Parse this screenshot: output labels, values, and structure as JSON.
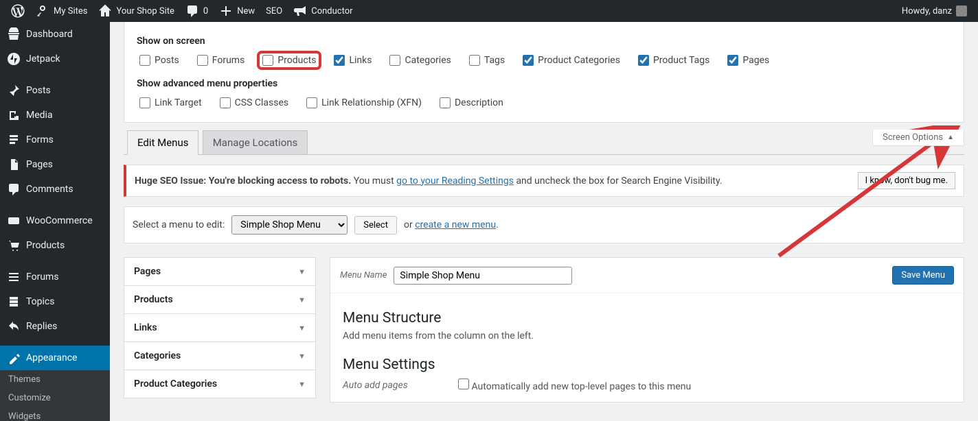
{
  "adminbar": {
    "my_sites": "My Sites",
    "site_name": "Your Shop Site",
    "comments": "0",
    "new": "New",
    "seo": "SEO",
    "conductor": "Conductor",
    "howdy": "Howdy, danz"
  },
  "sidebar": {
    "items": [
      {
        "icon": "dashboard",
        "label": "Dashboard"
      },
      {
        "icon": "jetpack",
        "label": "Jetpack"
      },
      {
        "icon": "pin",
        "label": "Posts"
      },
      {
        "icon": "media",
        "label": "Media"
      },
      {
        "icon": "forms",
        "label": "Forms"
      },
      {
        "icon": "pages",
        "label": "Pages"
      },
      {
        "icon": "comments",
        "label": "Comments"
      },
      {
        "icon": "woo",
        "label": "WooCommerce"
      },
      {
        "icon": "cart",
        "label": "Products"
      },
      {
        "icon": "forums",
        "label": "Forums"
      },
      {
        "icon": "topics",
        "label": "Topics"
      },
      {
        "icon": "replies",
        "label": "Replies"
      },
      {
        "icon": "appearance",
        "label": "Appearance",
        "current": true
      }
    ],
    "submenu": [
      "Themes",
      "Customize",
      "Widgets"
    ]
  },
  "screen_meta": {
    "show_title": "Show on screen",
    "boxes": [
      {
        "label": "Posts",
        "checked": false
      },
      {
        "label": "Forums",
        "checked": false
      },
      {
        "label": "Products",
        "checked": false,
        "hl": true
      },
      {
        "label": "Links",
        "checked": true
      },
      {
        "label": "Categories",
        "checked": false
      },
      {
        "label": "Tags",
        "checked": false
      },
      {
        "label": "Product Categories",
        "checked": true,
        "hlg": true
      },
      {
        "label": "Product Tags",
        "checked": true,
        "hlg": true
      },
      {
        "label": "Pages",
        "checked": true
      }
    ],
    "adv_title": "Show advanced menu properties",
    "adv": [
      {
        "label": "Link Target",
        "checked": false
      },
      {
        "label": "CSS Classes",
        "checked": false
      },
      {
        "label": "Link Relationship (XFN)",
        "checked": false
      },
      {
        "label": "Description",
        "checked": false
      }
    ]
  },
  "screen_options_tab": "Screen Options",
  "tabs": {
    "edit": "Edit Menus",
    "manage": "Manage Locations"
  },
  "notice": {
    "prefix": "Huge SEO Issue: You're blocking access to robots.",
    "text": " You must ",
    "link": "go to your Reading Settings",
    "suffix": " and uncheck the box for Search Engine Visibility.",
    "dismiss": "I know, don't bug me."
  },
  "menu_select": {
    "label": "Select a menu to edit:",
    "selected": "Simple Shop Menu",
    "button": "Select",
    "or": "or ",
    "create": "create a new menu",
    "dot": "."
  },
  "accordion": [
    "Pages",
    "Products",
    "Links",
    "Categories",
    "Product Categories"
  ],
  "menu_name": {
    "label": "Menu Name",
    "value": "Simple Shop Menu",
    "save": "Save Menu"
  },
  "structure": {
    "title": "Menu Structure",
    "help": "Add menu items from the column on the left."
  },
  "settings": {
    "title": "Menu Settings",
    "auto_label": "Auto add pages",
    "auto_text": "Automatically add new top-level pages to this menu"
  }
}
